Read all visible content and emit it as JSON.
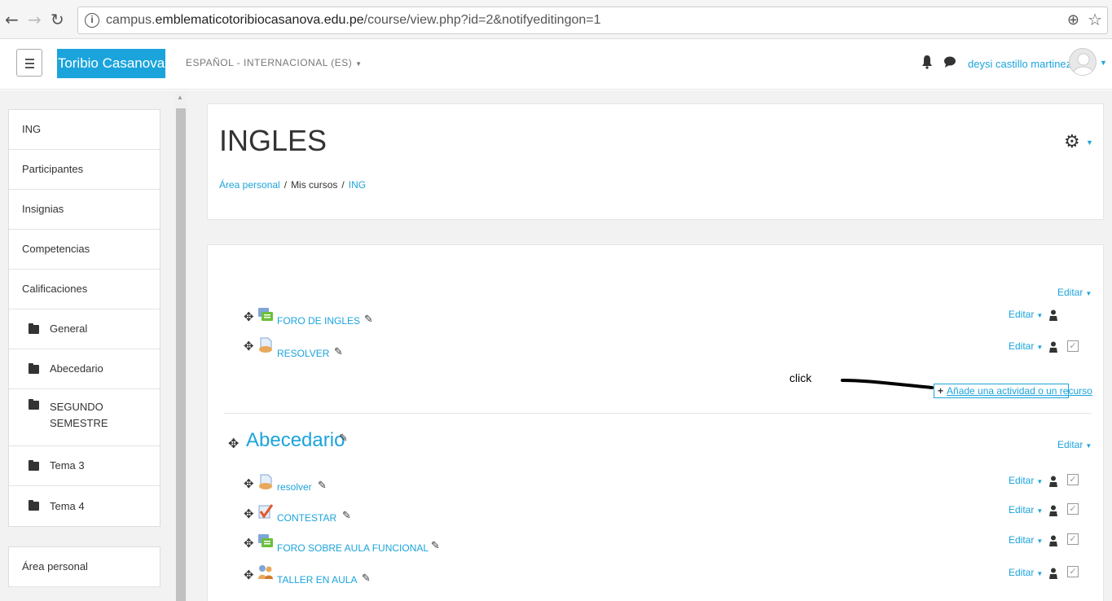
{
  "browser": {
    "url_prefix": "campus.",
    "url_host": "emblematicotoribiocasanova.edu.pe",
    "url_path": "/course/view.php?id=2&notifyeditingon=1"
  },
  "navbar": {
    "brand": "Toribio Casanova",
    "language": "ESPAÑOL - INTERNACIONAL (ES)",
    "username": "deysi castillo martinez"
  },
  "sidebar": {
    "items": [
      {
        "label": "ING"
      },
      {
        "label": "Participantes"
      },
      {
        "label": "Insignias"
      },
      {
        "label": "Competencias"
      },
      {
        "label": "Calificaciones"
      },
      {
        "label": "General"
      },
      {
        "label": "Abecedario"
      },
      {
        "label": "SEGUNDO SEMESTRE"
      },
      {
        "label": "Tema 3"
      },
      {
        "label": "Tema 4"
      }
    ],
    "block2": [
      {
        "label": "Área personal"
      }
    ]
  },
  "header": {
    "title": "INGLES",
    "breadcrumb": [
      "Área personal",
      "Mis cursos",
      "ING"
    ],
    "sep": "/"
  },
  "content": {
    "editar_label": "Editar",
    "section0_activities": [
      {
        "name": "FORO DE INGLES",
        "icon": "forum-icon"
      },
      {
        "name": "RESOLVER",
        "icon": "assignment-icon"
      }
    ],
    "add_activity": "Añade una actividad o un recurso",
    "click_note": "click",
    "section1_title": "Abecedario",
    "section1_activities": [
      {
        "name": "resolver",
        "icon": "assignment-icon"
      },
      {
        "name": "CONTESTAR",
        "icon": "quiz-icon"
      },
      {
        "name": "FORO SOBRE AULA FUNCIONAL",
        "icon": "forum-icon"
      },
      {
        "name": "TALLER EN AULA",
        "icon": "workshop-icon"
      }
    ]
  },
  "colors": {
    "accent": "#1ba4dc"
  }
}
